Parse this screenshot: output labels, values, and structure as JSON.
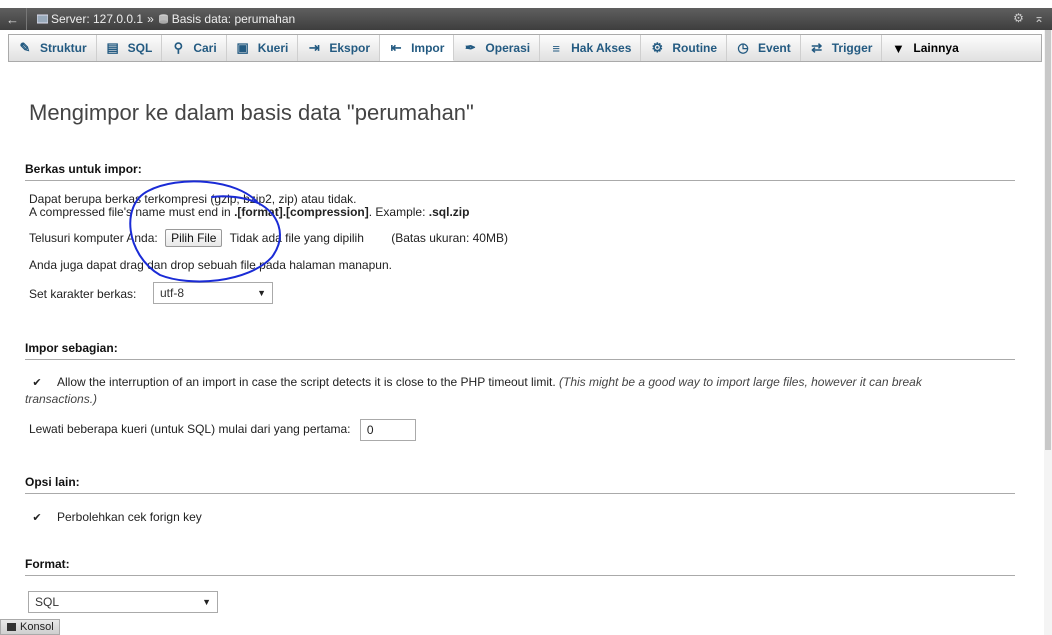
{
  "breadcrumb": {
    "back_glyph": "←",
    "server": "Server: 127.0.0.1",
    "separator": "»",
    "database": "Basis data: perumahan"
  },
  "window_controls": {
    "settings_glyph": "⚙",
    "collapse_glyph": "⌅"
  },
  "tabs": [
    {
      "label": "Struktur",
      "icon": "structure-icon",
      "glyph": "✎"
    },
    {
      "label": "SQL",
      "icon": "sql-icon",
      "glyph": "▤"
    },
    {
      "label": "Cari",
      "icon": "search-icon",
      "glyph": "⚲"
    },
    {
      "label": "Kueri",
      "icon": "query-icon",
      "glyph": "▣"
    },
    {
      "label": "Ekspor",
      "icon": "export-icon",
      "glyph": "⇥"
    },
    {
      "label": "Impor",
      "icon": "import-icon",
      "glyph": "⇤"
    },
    {
      "label": "Operasi",
      "icon": "operations-icon",
      "glyph": "✒"
    },
    {
      "label": "Hak Akses",
      "icon": "privileges-icon",
      "glyph": "≡"
    },
    {
      "label": "Routine",
      "icon": "routine-icon",
      "glyph": "⚙"
    },
    {
      "label": "Event",
      "icon": "event-icon",
      "glyph": "◷"
    },
    {
      "label": "Trigger",
      "icon": "trigger-icon",
      "glyph": "⇄"
    },
    {
      "label": "Lainnya",
      "icon": "dropdown-icon",
      "glyph": "▼"
    }
  ],
  "active_tab": "Impor",
  "page_title": "Mengimpor ke dalam basis data \"perumahan\"",
  "file_section": {
    "title": "Berkas untuk impor:",
    "note1": "Dapat berupa berkas terkompresi (gzip, bzip2, zip) atau tidak.",
    "note2_prefix": "A compressed file's name must end in ",
    "note2_bold": ".[format].[compression]",
    "note2_mid": ". Example: ",
    "note2_example": ".sql.zip",
    "browse_label": "Telusuri komputer Anda:",
    "choose_button": "Pilih File",
    "no_file": "Tidak ada file yang dipilih",
    "size_limit": "(Batas ukuran: 40MB)",
    "drag_note": "Anda juga dapat drag dan drop sebuah file pada halaman manapun.",
    "charset_label": "Set karakter berkas:",
    "charset_value": "utf-8"
  },
  "partial_section": {
    "title": "Impor sebagian:",
    "interrupt_text": "Allow the interruption of an import in case the script detects it is close to the PHP timeout limit.",
    "interrupt_hint": "(This might be a good way to import large files, however it can break transactions.)",
    "interrupt_hint_line1": "(This might be a good way to import large files, however it can break",
    "interrupt_hint_line2": "transactions.)",
    "interrupt_checked": true,
    "skip_label": "Lewati beberapa kueri (untuk SQL) mulai dari yang pertama:",
    "skip_value": "0"
  },
  "other_section": {
    "title": "Opsi lain:",
    "fk_label": "Perbolehkan cek forign key",
    "fk_checked": true
  },
  "format_section": {
    "title": "Format:",
    "value": "SQL"
  },
  "console": {
    "label": "Konsol"
  },
  "colors": {
    "tab_text": "#235a81",
    "annotation": "#1a2bd6",
    "topbar": "#4a4a4a"
  }
}
